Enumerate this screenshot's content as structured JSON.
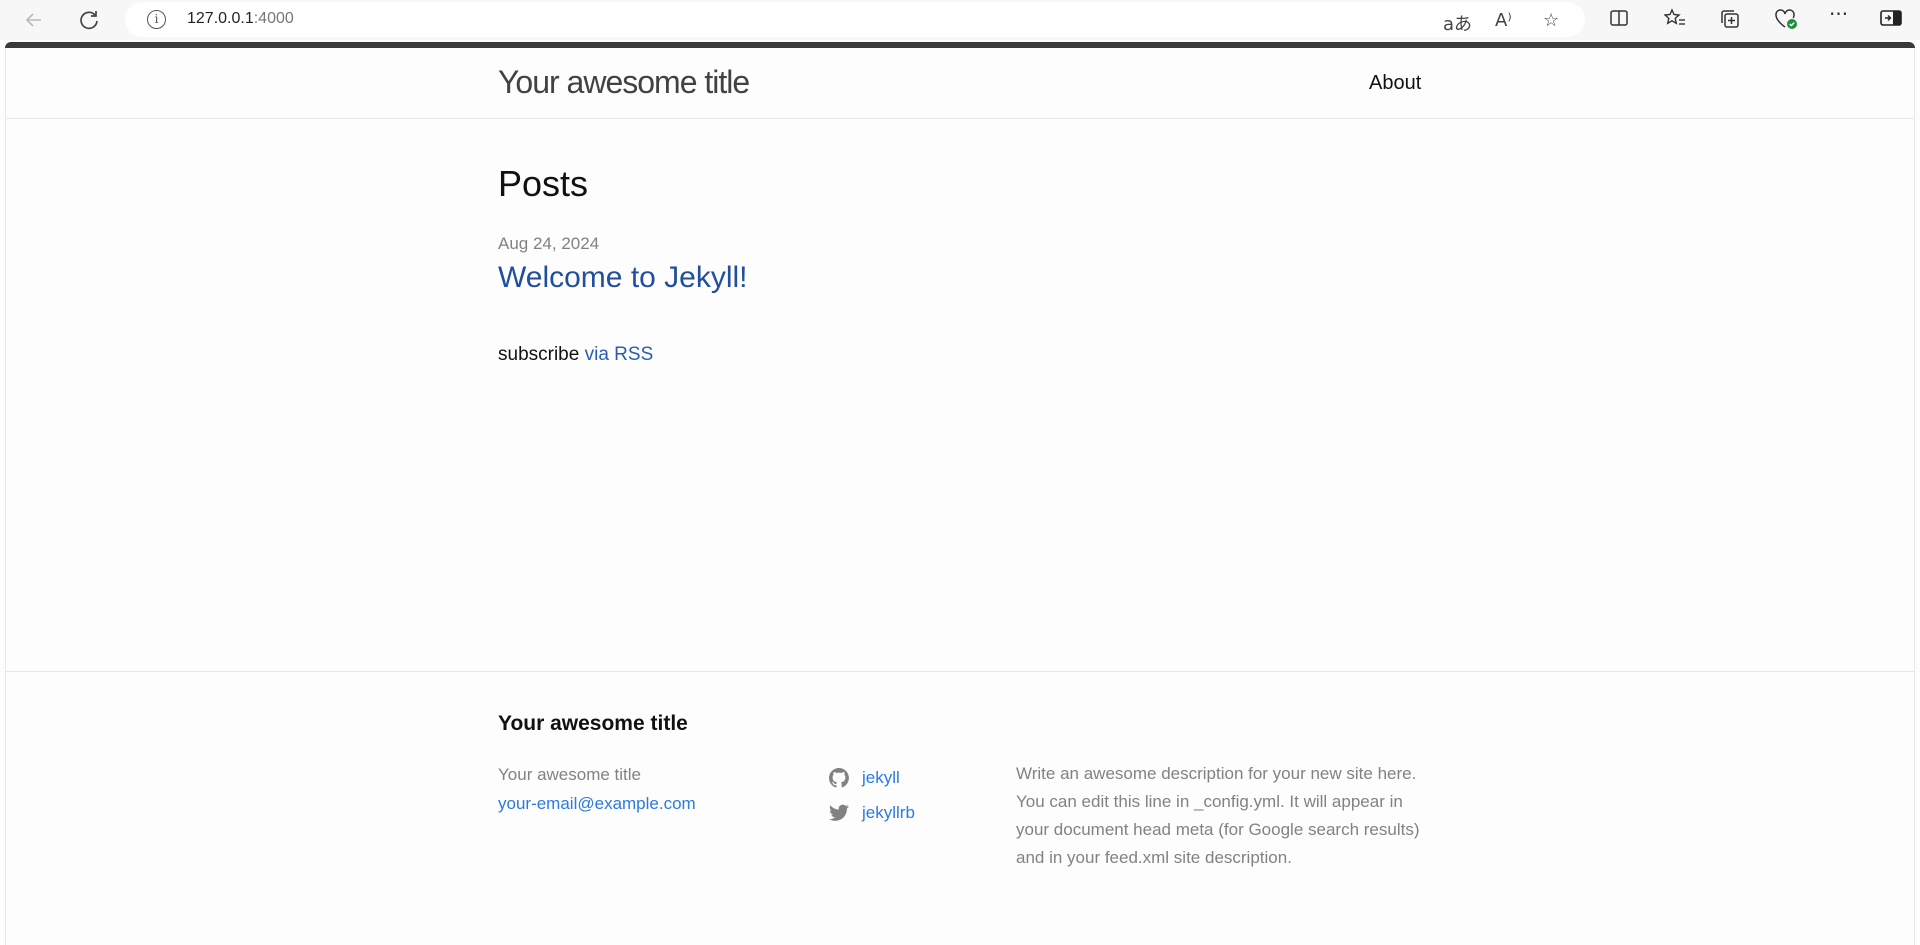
{
  "browser": {
    "url_host": "127.0.0.1",
    "url_port": ":4000",
    "icons": [
      "back-icon",
      "reload-icon",
      "info-icon",
      "translate-icon",
      "read-aloud-icon",
      "favorite-star-icon",
      "split-screen-icon",
      "favorites-icon",
      "collections-icon",
      "browser-essentials-icon",
      "more-icon",
      "sidebar-icon"
    ]
  },
  "header": {
    "site_title": "Your awesome title",
    "nav_about": "About"
  },
  "main": {
    "heading": "Posts",
    "posts": [
      {
        "date": "Aug 24, 2024",
        "title": "Welcome to Jekyll!"
      }
    ],
    "subscribe_prefix": "subscribe ",
    "subscribe_link": "via RSS"
  },
  "footer": {
    "heading": "Your awesome title",
    "name": "Your awesome title",
    "email": "your-email@example.com",
    "social": [
      {
        "icon": "github-icon",
        "label": "jekyll"
      },
      {
        "icon": "twitter-icon",
        "label": "jekyllrb"
      }
    ],
    "description": "Write an awesome description for your new site here. You can edit this line in _config.yml. It will appear in your document head meta (for Google search results) and in your feed.xml site description."
  },
  "colors": {
    "link": "#2a7ae2",
    "muted": "#828282",
    "border": "#e8e8e8"
  }
}
